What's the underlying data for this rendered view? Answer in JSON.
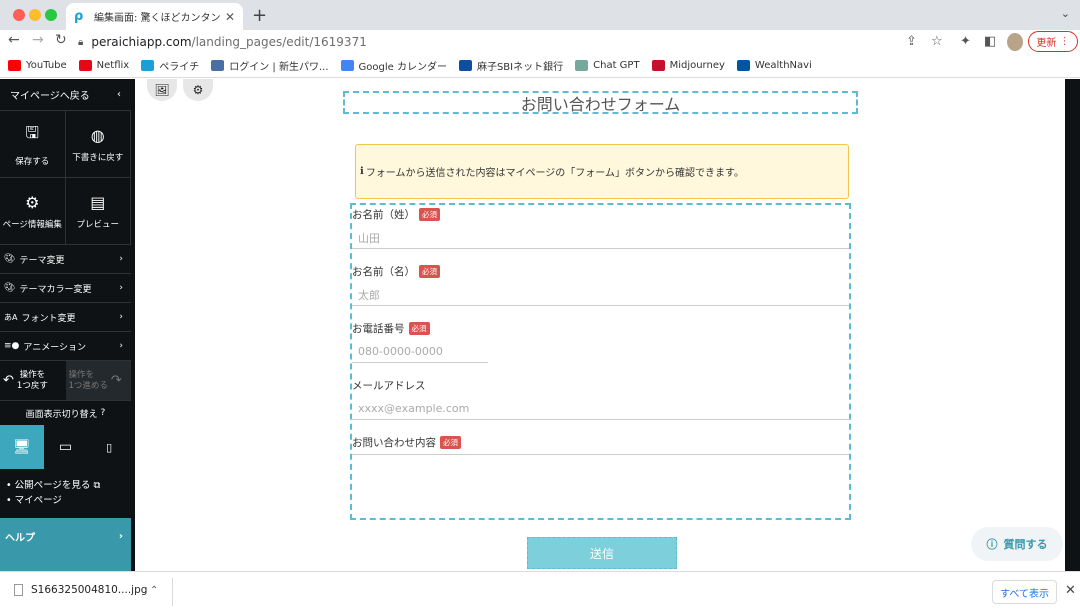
{
  "browser": {
    "tab_title": "編集画面: 驚くほどカンタン！無料",
    "url_host": "peraichiapp.com",
    "url_path": "/landing_pages/edit/1619371",
    "update_label": "更新",
    "bookmarks": [
      {
        "label": "YouTube",
        "icon": "youtube-icon",
        "color": "#ff0000"
      },
      {
        "label": "Netflix",
        "icon": "netflix-icon",
        "color": "#e50914"
      },
      {
        "label": "ペライチ",
        "icon": "peraichi-icon",
        "color": "#1a9fd8"
      },
      {
        "label": "ログイン | 新生パワ...",
        "icon": "login-icon",
        "color": "#4a6fa5"
      },
      {
        "label": "Google カレンダー",
        "icon": "calendar-icon",
        "color": "#4285f4"
      },
      {
        "label": "麻子SBIネット銀行",
        "icon": "bank-icon",
        "color": "#0b4ea2"
      },
      {
        "label": "Chat GPT",
        "icon": "chatgpt-icon",
        "color": "#74aa9c"
      },
      {
        "label": "Midjourney",
        "icon": "midjourney-icon",
        "color": "#c8102e"
      },
      {
        "label": "WealthNavi",
        "icon": "wealthnavi-icon",
        "color": "#0055a5"
      }
    ]
  },
  "sidebar": {
    "back_label": "マイページへ戻る",
    "save_label": "保存する",
    "revert_label": "下書きに戻す",
    "page_info_label": "ページ情報編集",
    "preview_label": "プレビュー",
    "menu": [
      {
        "label": "テーマ変更"
      },
      {
        "label": "テーマカラー変更"
      },
      {
        "label": "フォント変更"
      },
      {
        "label": "アニメーション"
      }
    ],
    "undo_label_1": "操作を",
    "undo_label_2": "1つ戻す",
    "redo_label_1": "操作を",
    "redo_label_2": "1つ進める",
    "display_switch_label": "画面表示切り替え",
    "public_page_link": "公開ページを見る",
    "mypage_link": "マイページ",
    "help_label": "ヘルプ"
  },
  "form": {
    "title": "お問い合わせフォーム",
    "notice": "フォームから送信された内容はマイページの「フォーム」ボタンから確認できます。",
    "required_badge": "必須",
    "fields": [
      {
        "label": "お名前（姓）",
        "placeholder": "山田"
      },
      {
        "label": "お名前（名）",
        "placeholder": "太郎"
      },
      {
        "label": "お電話番号",
        "placeholder": "080-0000-0000"
      },
      {
        "label": "メールアドレス",
        "placeholder": "xxxx@example.com"
      },
      {
        "label": "お問い合わせ内容",
        "placeholder": ""
      }
    ],
    "submit_label": "送信"
  },
  "ask_button_label": "質問する",
  "downloads": {
    "file_name": "S166325004810....jpg",
    "show_all_label": "すべて表示"
  },
  "colors": {
    "accent": "#3a98ab",
    "dashed_outline": "#5bbcd3",
    "required": "#d9534f"
  }
}
